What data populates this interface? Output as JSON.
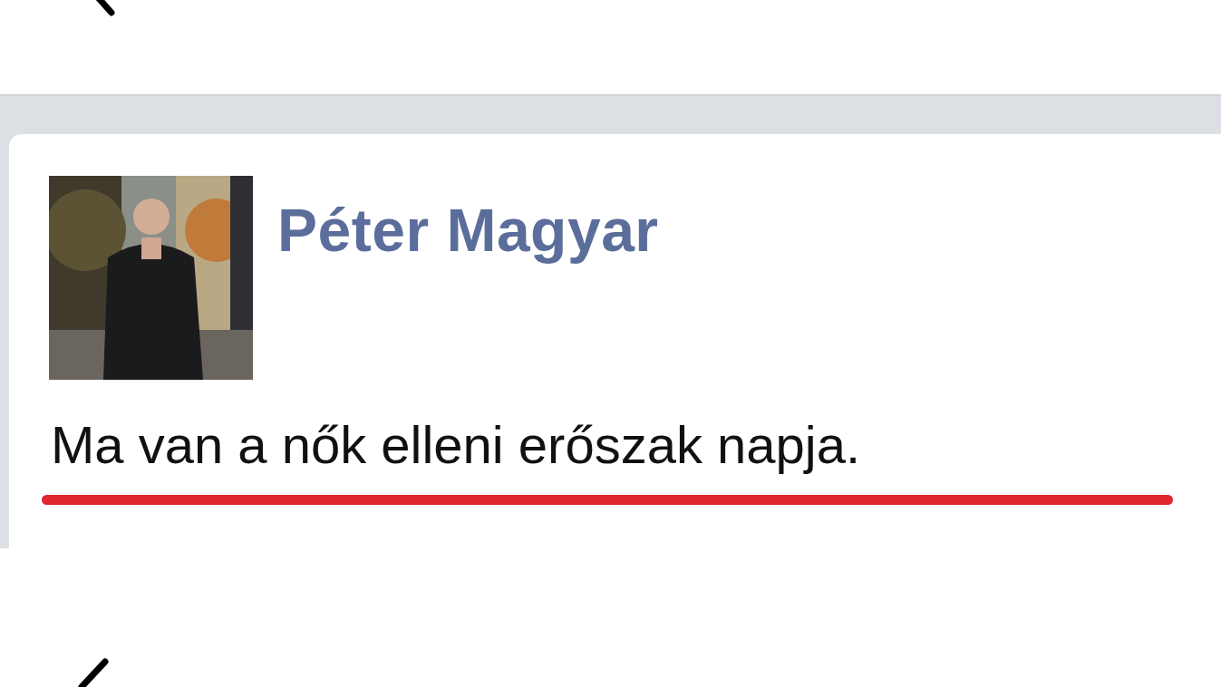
{
  "post": {
    "author": "Péter Magyar",
    "text": "Ma van a nők elleni erőszak napja.",
    "underlined": true
  }
}
